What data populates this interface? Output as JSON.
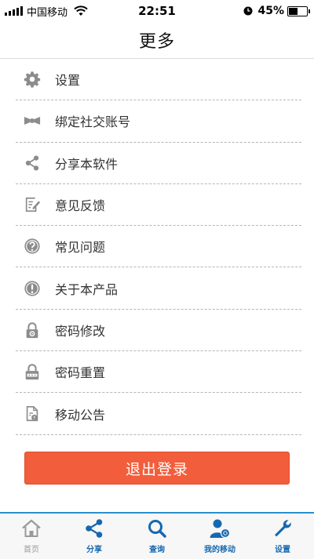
{
  "status_bar": {
    "carrier": "中国移动",
    "time": "22:51",
    "battery_text": "45%",
    "battery_level": 0.45
  },
  "nav": {
    "title": "更多"
  },
  "menu": [
    {
      "label": "设置",
      "icon": "gear-icon"
    },
    {
      "label": "绑定社交账号",
      "icon": "bow-tie-icon"
    },
    {
      "label": "分享本软件",
      "icon": "share-icon"
    },
    {
      "label": "意见反馈",
      "icon": "edit-note-icon"
    },
    {
      "label": "常见问题",
      "icon": "question-circle-icon"
    },
    {
      "label": "关于本产品",
      "icon": "exclamation-circle-icon"
    },
    {
      "label": "密码修改",
      "icon": "lock-gear-icon"
    },
    {
      "label": "密码重置",
      "icon": "lock-dots-icon"
    },
    {
      "label": "移动公告",
      "icon": "announcement-doc-icon"
    }
  ],
  "logout_label": "退出登录",
  "tabs": [
    {
      "label": "首页",
      "icon": "home-icon",
      "active": false
    },
    {
      "label": "分享",
      "icon": "share-icon",
      "active": true
    },
    {
      "label": "查询",
      "icon": "search-icon",
      "active": true
    },
    {
      "label": "我的移动",
      "icon": "user-icon",
      "active": true
    },
    {
      "label": "设置",
      "icon": "wrench-icon",
      "active": true
    }
  ],
  "colors": {
    "logout": "#f25e3c",
    "tab_accent": "#1568b0",
    "tab_border": "#2a8fcd",
    "icon_gray": "#8c8c8c"
  }
}
